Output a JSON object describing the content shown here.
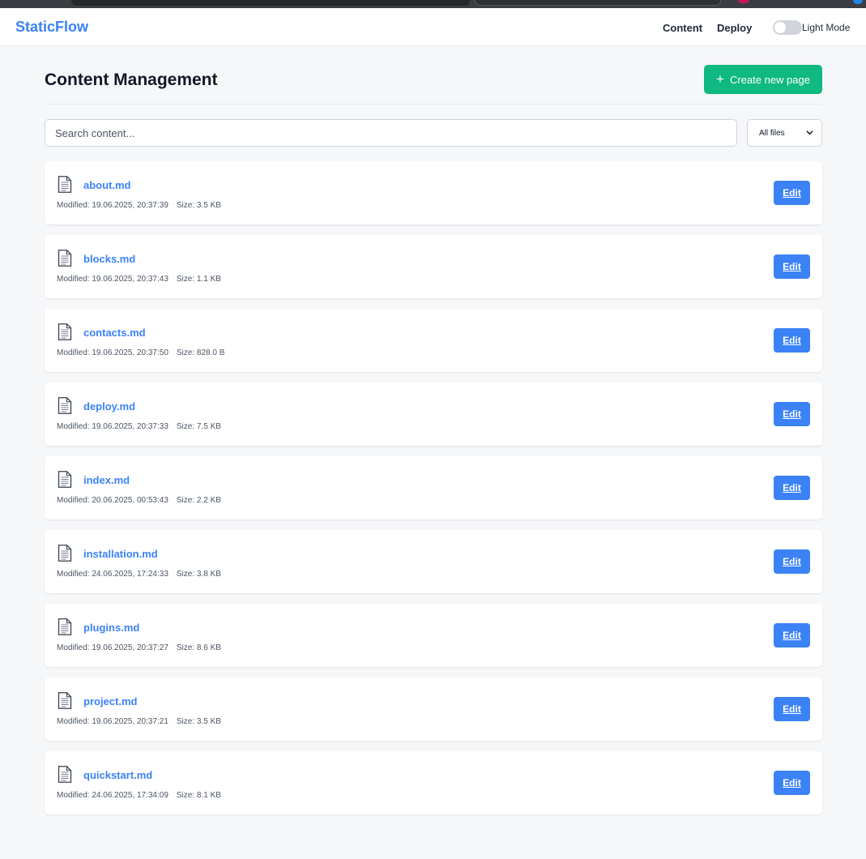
{
  "app": {
    "brand": "StaticFlow"
  },
  "nav": {
    "content": "Content",
    "deploy": "Deploy",
    "theme_label": "Light Mode"
  },
  "main": {
    "title": "Content Management",
    "create_label": "Create new page",
    "search_placeholder": "Search content...",
    "filter_value": "All files",
    "modified_prefix": "Modified:",
    "size_prefix": "Size:",
    "edit_label": "Edit",
    "files": [
      {
        "name": "about.md",
        "modified": "19.06.2025, 20:37:39",
        "size": "3.5 KB"
      },
      {
        "name": "blocks.md",
        "modified": "19.06.2025, 20:37:43",
        "size": "1.1 KB"
      },
      {
        "name": "contacts.md",
        "modified": "19.06.2025, 20:37:50",
        "size": "828.0 B"
      },
      {
        "name": "deploy.md",
        "modified": "19.06.2025, 20:37:33",
        "size": "7.5 KB"
      },
      {
        "name": "index.md",
        "modified": "20.06.2025, 00:53:43",
        "size": "2.2 KB"
      },
      {
        "name": "installation.md",
        "modified": "24.06.2025, 17:24:33",
        "size": "3.8 KB"
      },
      {
        "name": "plugins.md",
        "modified": "19.06.2025, 20:37:27",
        "size": "8.6 KB"
      },
      {
        "name": "project.md",
        "modified": "19.06.2025, 20:37:21",
        "size": "3.5 KB"
      },
      {
        "name": "quickstart.md",
        "modified": "24.06.2025, 17:34:09",
        "size": "8.1 KB"
      }
    ]
  },
  "colors": {
    "brand": "#3b82f6",
    "create_button": "#10b981",
    "edit_button": "#3b82f6",
    "background": "#f6f7f9"
  },
  "icons": {
    "file": "document-icon",
    "create": "plus-icon",
    "filter": "chevron-down-icon",
    "theme": "toggle-switch"
  }
}
